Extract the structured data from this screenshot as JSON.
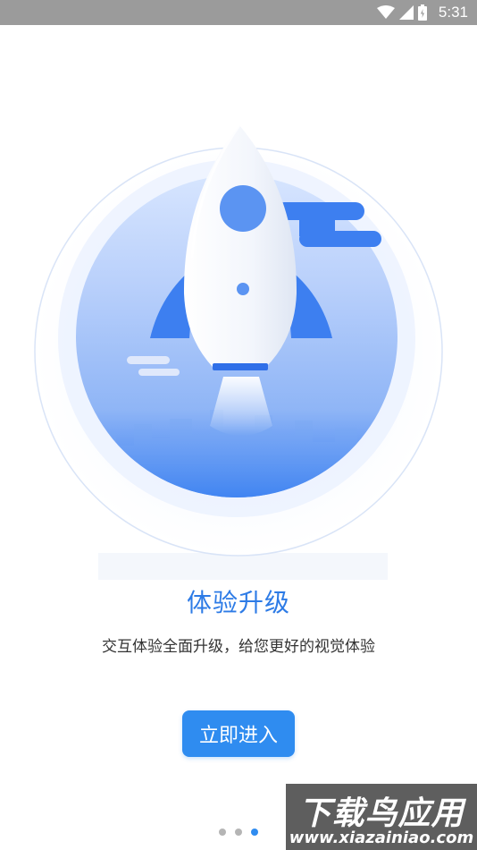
{
  "status_bar": {
    "time": "5:31",
    "icons": [
      "wifi-icon",
      "cellular-signal-icon",
      "battery-icon"
    ]
  },
  "onboarding": {
    "illustration": "rocket-launch-illustration",
    "title": "体验升级",
    "subtitle": "交互体验全面升级，给您更好的视觉体验",
    "button_label": "立即进入",
    "pages": 3,
    "active_page": 3
  },
  "watermark": {
    "title": "下载鸟应用",
    "url": "www.xiazainiao.com"
  },
  "colors": {
    "accent": "#2f8cf0",
    "title_blue": "#2d7be6",
    "status_bar": "#9b9b9b",
    "dot_inactive": "#b5b5b5"
  }
}
